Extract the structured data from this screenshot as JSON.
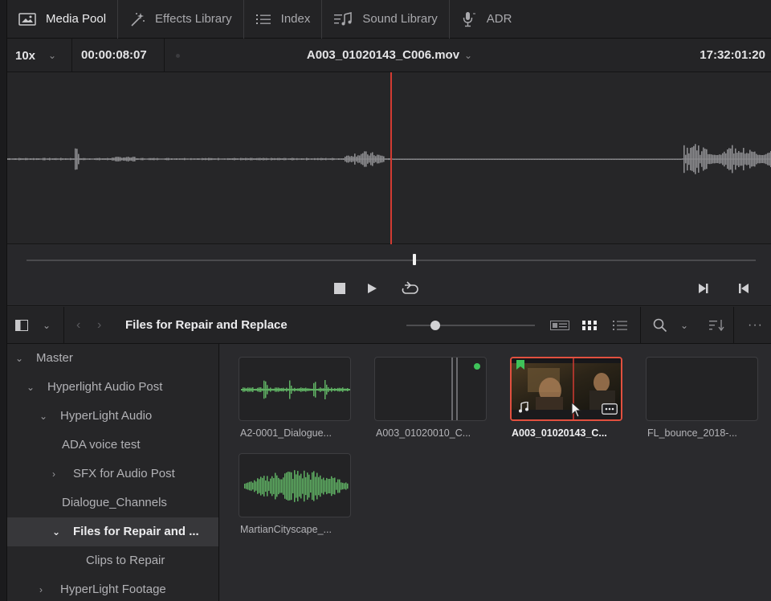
{
  "tabs": [
    {
      "label": "Media Pool",
      "icon": "media-pool-icon",
      "active": true
    },
    {
      "label": "Effects Library",
      "icon": "effects-wand-icon",
      "active": false
    },
    {
      "label": "Index",
      "icon": "index-list-icon",
      "active": false
    },
    {
      "label": "Sound Library",
      "icon": "sound-library-icon",
      "active": false
    },
    {
      "label": "ADR",
      "icon": "microphone-icon",
      "active": false
    }
  ],
  "viewer": {
    "zoom": "10x",
    "timecode": "00:00:08:07",
    "clip_name": "A003_01020143_C006.mov",
    "source_timecode": "17:32:01:20"
  },
  "transport": {
    "stop": "stop-icon",
    "play": "play-icon",
    "loop": "loop-icon",
    "next": "next-frame-icon",
    "prev": "prev-frame-icon"
  },
  "pool_toolbar": {
    "bin_title": "Files for Repair and Replace"
  },
  "bins": [
    {
      "label": "Master",
      "arrow": "v",
      "indent": 10
    },
    {
      "label": "Hyperlight Audio Post",
      "arrow": "v",
      "indent": 24
    },
    {
      "label": "HyperLight Audio",
      "arrow": "v",
      "indent": 40
    },
    {
      "label": "ADA voice test",
      "arrow": "",
      "indent": 68
    },
    {
      "label": "SFX for Audio Post",
      "arrow": ">",
      "indent": 56
    },
    {
      "label": "Dialogue_Channels",
      "arrow": "",
      "indent": 68
    },
    {
      "label": "Files for Repair and ...",
      "arrow": "v",
      "indent": 56,
      "selected": true
    },
    {
      "label": "Clips to Repair",
      "arrow": "",
      "indent": 98
    },
    {
      "label": "HyperLight Footage",
      "arrow": ">",
      "indent": 40
    }
  ],
  "clips": [
    {
      "label": "A2-0001_Dialogue...",
      "kind": "audio-wave"
    },
    {
      "label": "A003_01020010_C...",
      "kind": "blank-lines"
    },
    {
      "label": "A003_01020143_C...",
      "kind": "video",
      "selected": true
    },
    {
      "label": "FL_bounce_2018-...",
      "kind": "blank"
    },
    {
      "label": "MartianCityscape_...",
      "kind": "audio-dense"
    }
  ],
  "colors": {
    "accent_red": "#e2503f",
    "playhead_red": "#d23b32",
    "waveform": "#8c8c8f",
    "clip_wave": "#5fb063",
    "flag_green": "#3fc35a"
  }
}
